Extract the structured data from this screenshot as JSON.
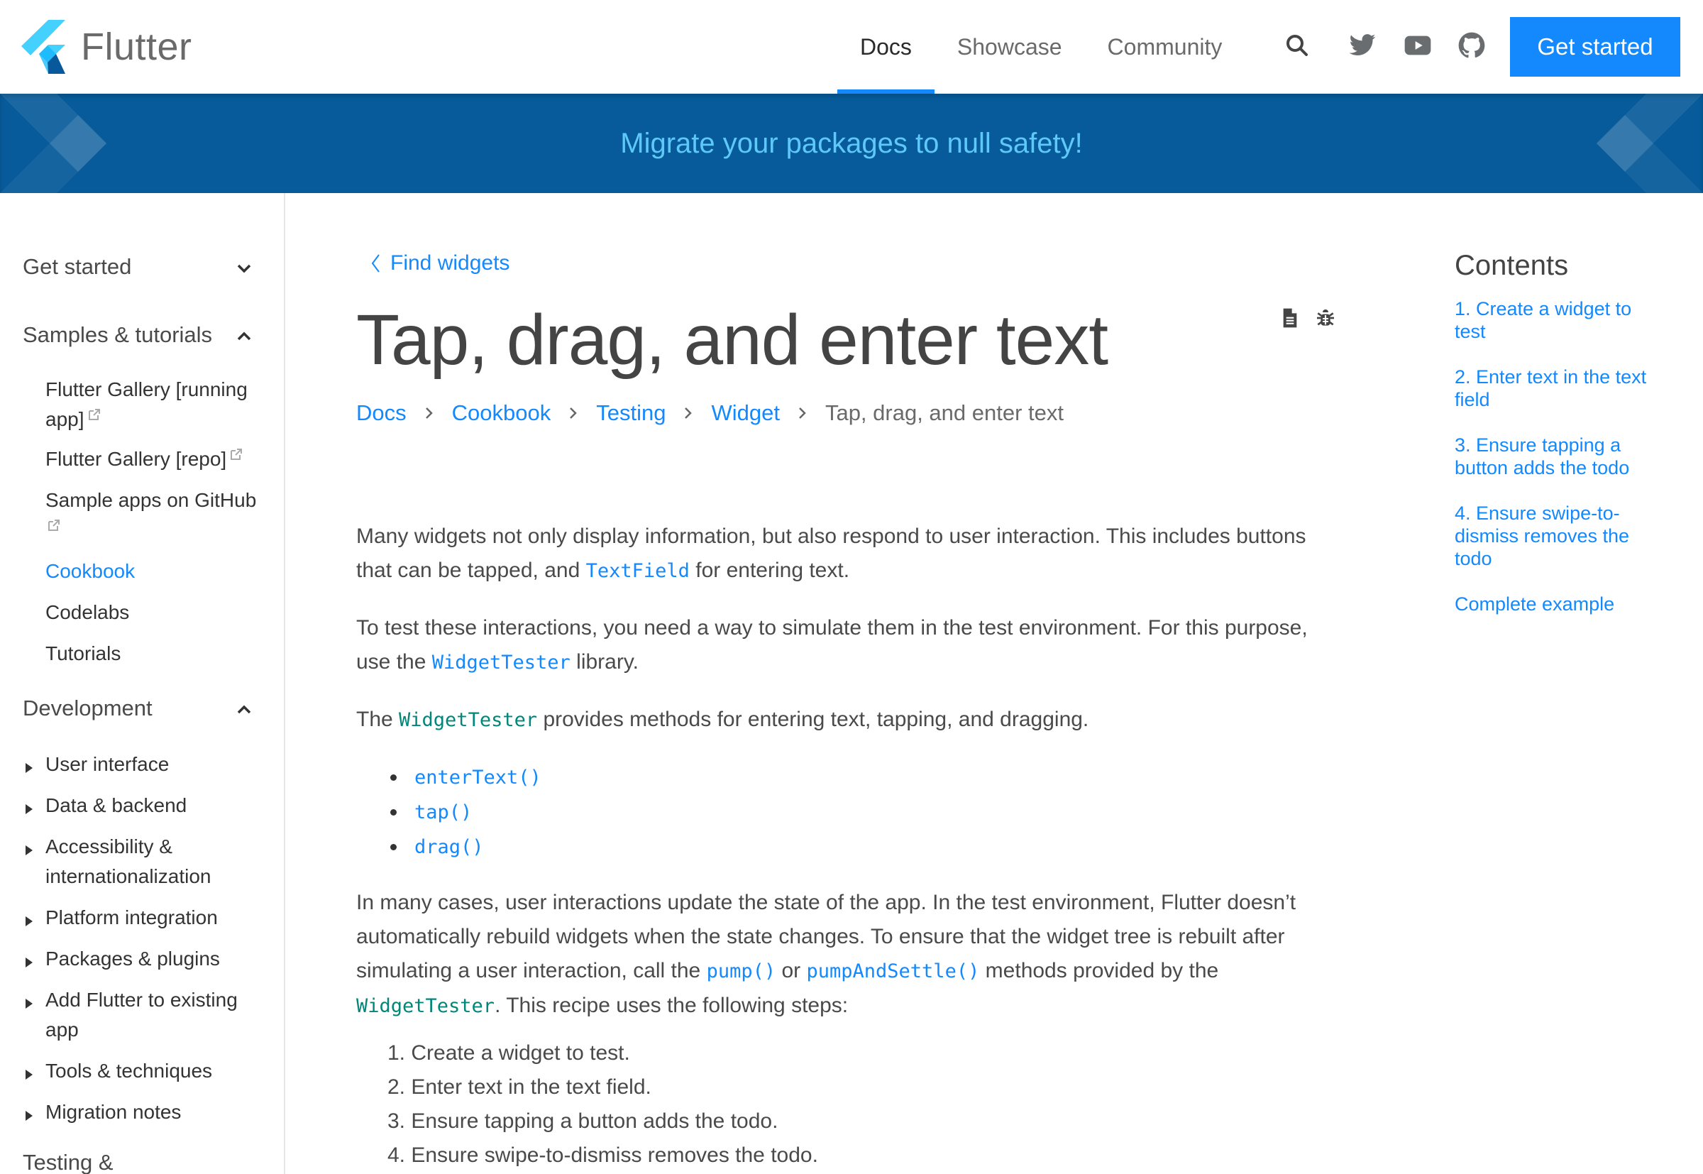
{
  "header": {
    "brand": "Flutter",
    "nav": [
      {
        "label": "Docs",
        "active": true
      },
      {
        "label": "Showcase",
        "active": false
      },
      {
        "label": "Community",
        "active": false
      }
    ],
    "icons": [
      "search-icon",
      "twitter-icon",
      "youtube-icon",
      "github-icon"
    ],
    "cta_label": "Get started"
  },
  "banner": {
    "text": "Migrate your packages to null safety!"
  },
  "sidebar": {
    "sections": [
      {
        "label": "Get started",
        "expanded": false
      },
      {
        "label": "Samples & tutorials",
        "expanded": true
      },
      {
        "label": "Development",
        "expanded": true
      },
      {
        "label": "Testing &",
        "expanded": false
      }
    ],
    "samples_items": [
      {
        "label": "Flutter Gallery [running app]",
        "external": true
      },
      {
        "label": "Flutter Gallery [repo]",
        "external": true
      },
      {
        "label": "Sample apps on GitHub",
        "external": true
      },
      {
        "label": "Cookbook",
        "active": true
      },
      {
        "label": "Codelabs"
      },
      {
        "label": "Tutorials"
      }
    ],
    "development_items": [
      {
        "label": "User interface"
      },
      {
        "label": "Data & backend"
      },
      {
        "label": "Accessibility & internationalization"
      },
      {
        "label": "Platform integration"
      },
      {
        "label": "Packages & plugins"
      },
      {
        "label": "Add Flutter to existing app"
      },
      {
        "label": "Tools & techniques"
      },
      {
        "label": "Migration notes"
      }
    ]
  },
  "main": {
    "back_link": "Find widgets",
    "title": "Tap, drag, and enter text",
    "page_icons": [
      "view-source-icon",
      "report-bug-icon"
    ],
    "breadcrumb": [
      {
        "label": "Docs",
        "link": true
      },
      {
        "label": "Cookbook",
        "link": true
      },
      {
        "label": "Testing",
        "link": true
      },
      {
        "label": "Widget",
        "link": true
      },
      {
        "label": "Tap, drag, and enter text",
        "link": false
      }
    ],
    "p1": {
      "a": "Many widgets not only display information, but also respond to user interaction. This includes buttons that can be tapped, and ",
      "code": "TextField",
      "b": " for entering text."
    },
    "p2": {
      "a": "To test these interactions, you need a way to simulate them in the test environment. For this purpose, use the ",
      "code": "WidgetTester",
      "b": " library."
    },
    "p3": {
      "a": "The ",
      "code": "WidgetTester",
      "b": " provides methods for entering text, tapping, and dragging."
    },
    "methods": [
      "enterText()",
      "tap()",
      "drag()"
    ],
    "p4": {
      "a": "In many cases, user interactions update the state of the app. In the test environment, Flutter doesn’t automatically rebuild widgets when the state changes. To ensure that the widget tree is rebuilt after simulating a user interaction, call the ",
      "code1": "pump()",
      "mid": " or ",
      "code2": "pumpAndSettle()",
      "c": " methods provided by the ",
      "code3": "WidgetTester",
      "d": ". This recipe uses the following steps:"
    },
    "steps": [
      "1. Create a widget to test.",
      "2. Enter text in the text field.",
      "3. Ensure tapping a button adds the todo.",
      "4. Ensure swipe-to-dismiss removes the todo."
    ]
  },
  "toc": {
    "title": "Contents",
    "items": [
      "1. Create a widget to test",
      "2. Enter text in the text field",
      "3. Ensure tapping a button adds the todo",
      "4. Ensure swipe-to-dismiss removes the todo",
      "Complete example"
    ]
  },
  "colors": {
    "accent": "#1389fd",
    "banner_bg": "#075b9a",
    "banner_text": "#5ec8f8",
    "code_teal": "#008779"
  }
}
